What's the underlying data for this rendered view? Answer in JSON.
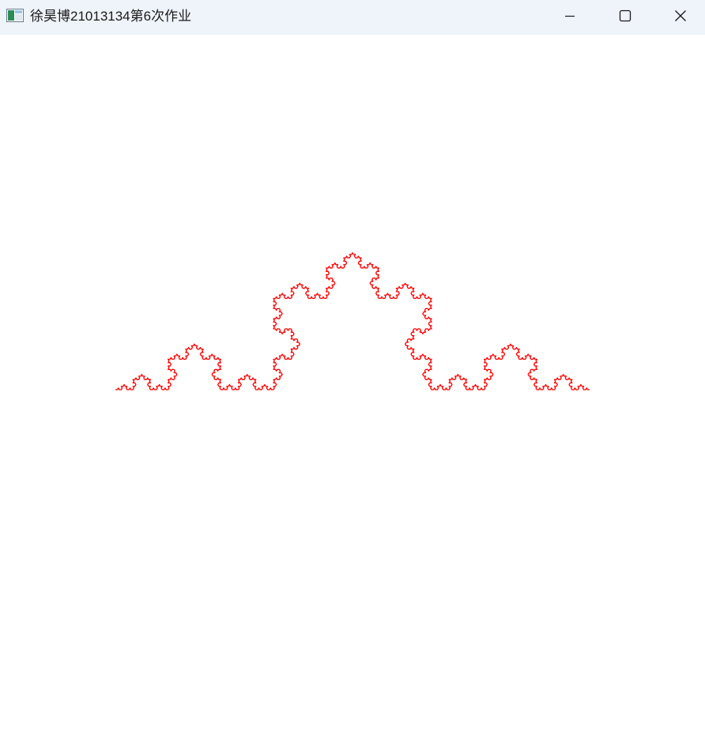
{
  "window": {
    "title": "徐昊博21013134第6次作业",
    "icon": "application-window-icon",
    "controls": {
      "minimize": "minimize-icon",
      "maximize": "maximize-icon",
      "close": "close-icon"
    }
  },
  "canvas": {
    "background": "#ffffff",
    "curve": {
      "shape": "koch-curve",
      "color": "#ff0000",
      "iterations": 5
    }
  }
}
